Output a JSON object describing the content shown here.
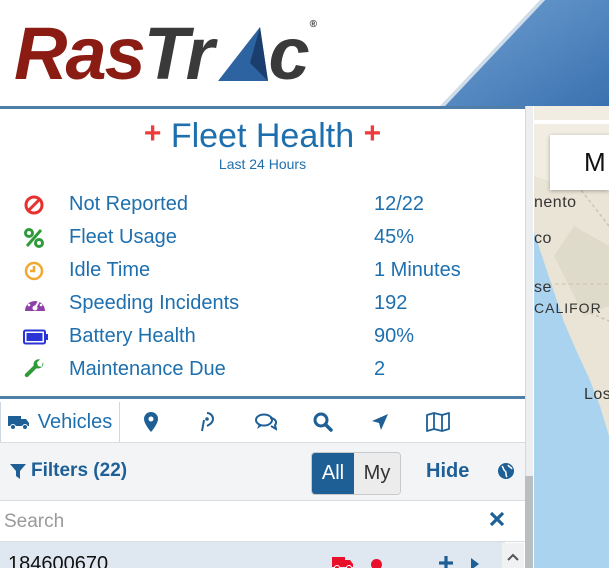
{
  "brand": {
    "logo_part1": "Ras",
    "logo_part2": "Trac",
    "registered": "®",
    "logo_colors": {
      "ras": "#8a1c14",
      "trac": "#3a3a3a",
      "triangle": "#2d63a0"
    }
  },
  "fleet_health": {
    "title": "Fleet Health",
    "subtitle": "Last 24 Hours",
    "metrics": [
      {
        "icon": "not-reported-icon",
        "label": "Not Reported",
        "value": "12/22",
        "color": "#e8312e"
      },
      {
        "icon": "percent-icon",
        "label": "Fleet Usage",
        "value": "45%",
        "color": "#2e9a3a"
      },
      {
        "icon": "clock-icon",
        "label": "Idle Time",
        "value": "1 Minutes",
        "color": "#f0a830"
      },
      {
        "icon": "speedometer-icon",
        "label": "Speeding Incidents",
        "value": "192",
        "color": "#8e3fa8"
      },
      {
        "icon": "battery-icon",
        "label": "Battery Health",
        "value": "90%",
        "color": "#2a34d6"
      },
      {
        "icon": "wrench-icon",
        "label": "Maintenance Due",
        "value": "2",
        "color": "#2e9a3a"
      }
    ]
  },
  "tabs": {
    "active_label": "Vehicles",
    "items": [
      "truck-icon",
      "map-marker-icon",
      "geofence-icon",
      "chat-icon",
      "search-icon",
      "navigation-icon",
      "map-icon"
    ]
  },
  "filters": {
    "label": "Filters (22)",
    "all_label": "All",
    "my_label": "My",
    "hide_label": "Hide"
  },
  "search": {
    "placeholder": "Search",
    "value": ""
  },
  "vehicles": [
    {
      "id": "184600670",
      "status_color": "#e8102a"
    }
  ],
  "map": {
    "card_text": "M",
    "labels": [
      "nento",
      "co",
      "se",
      "CALIFOR",
      "Los"
    ]
  },
  "colors": {
    "accent": "#1e6fae",
    "header_blue": "#2d5f96",
    "divider": "#4f7fa6"
  }
}
